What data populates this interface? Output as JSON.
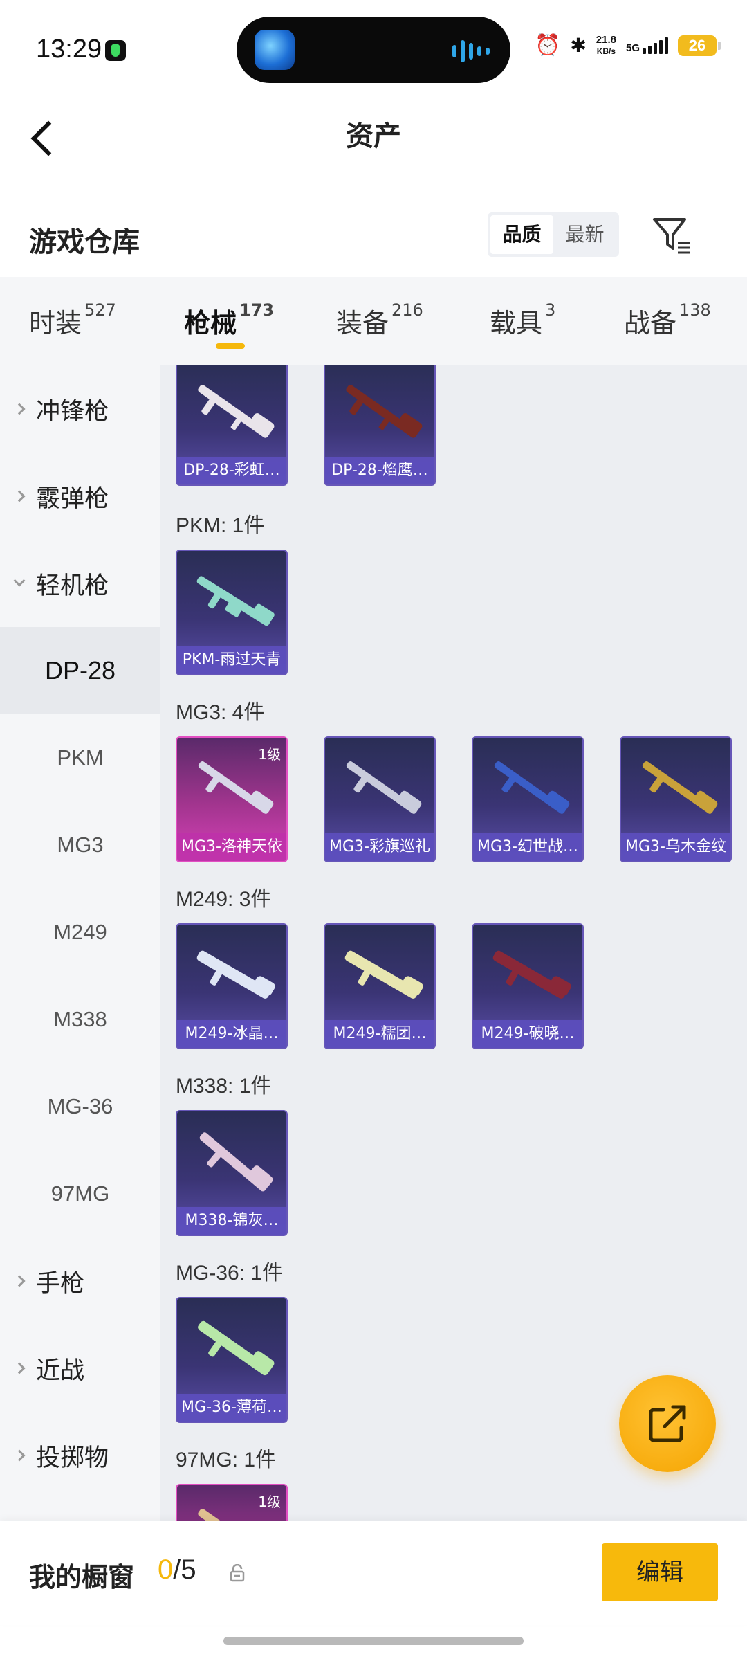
{
  "status_bar": {
    "time": "13:29",
    "speed": "21.8",
    "speed_unit": "KB/s",
    "network": "5G",
    "battery": "26"
  },
  "nav": {
    "title": "资产"
  },
  "warehouse": {
    "title": "游戏仓库",
    "sort_options": [
      "品质",
      "最新"
    ],
    "active_sort": "品质"
  },
  "tabs": [
    {
      "label": "时装",
      "count": "527"
    },
    {
      "label": "枪械",
      "count": "173",
      "active": true
    },
    {
      "label": "装备",
      "count": "216"
    },
    {
      "label": "载具",
      "count": "3"
    },
    {
      "label": "战备",
      "count": "138"
    }
  ],
  "sidebar": {
    "items": [
      {
        "label": "冲锋枪",
        "type": "group"
      },
      {
        "label": "霰弹枪",
        "type": "group"
      },
      {
        "label": "轻机枪",
        "type": "group",
        "open": true
      },
      {
        "label": "DP-28",
        "type": "sub",
        "selected": true
      },
      {
        "label": "PKM",
        "type": "sub"
      },
      {
        "label": "MG3",
        "type": "sub"
      },
      {
        "label": "M249",
        "type": "sub"
      },
      {
        "label": "M338",
        "type": "sub"
      },
      {
        "label": "MG-36",
        "type": "sub"
      },
      {
        "label": "97MG",
        "type": "sub"
      },
      {
        "label": "手枪",
        "type": "group"
      },
      {
        "label": "近战",
        "type": "group"
      },
      {
        "label": "投掷物",
        "type": "group"
      }
    ]
  },
  "groups": [
    {
      "label": "",
      "items": [
        {
          "name": "DP-28-彩虹…",
          "tier": "epic",
          "gun_color": "#e9e4ea"
        },
        {
          "name": "DP-28-焰鹰…",
          "tier": "epic",
          "gun_color": "#7a2a22"
        }
      ]
    },
    {
      "label": "PKM: 1件",
      "items": [
        {
          "name": "PKM-雨过天青",
          "tier": "epic",
          "gun_color": "#8fd9c9"
        }
      ]
    },
    {
      "label": "MG3: 4件",
      "items": [
        {
          "name": "MG3-洛神天依",
          "tier": "legendary",
          "level": "1级",
          "gun_color": "#d8d8e8"
        },
        {
          "name": "MG3-彩旗巡礼",
          "tier": "epic",
          "gun_color": "#c9ccdc"
        },
        {
          "name": "MG3-幻世战…",
          "tier": "epic",
          "gun_color": "#3a5ec8"
        },
        {
          "name": "MG3-乌木金纹",
          "tier": "epic",
          "gun_color": "#c9a23a"
        }
      ]
    },
    {
      "label": "M249: 3件",
      "items": [
        {
          "name": "M249-冰晶…",
          "tier": "epic",
          "gun_color": "#dfe6f5"
        },
        {
          "name": "M249-糯团…",
          "tier": "epic",
          "gun_color": "#e8e6b0"
        },
        {
          "name": "M249-破晓…",
          "tier": "epic",
          "gun_color": "#8a2838"
        }
      ]
    },
    {
      "label": "M338: 1件",
      "items": [
        {
          "name": "M338-锦灰…",
          "tier": "epic",
          "gun_color": "#e0c8dc"
        }
      ]
    },
    {
      "label": "MG-36: 1件",
      "items": [
        {
          "name": "MG-36-薄荷…",
          "tier": "epic",
          "gun_color": "#b8e8a8"
        }
      ]
    },
    {
      "label": "97MG: 1件",
      "items": [
        {
          "name": "",
          "tier": "legendary",
          "level": "1级",
          "gun_color": "#e0c090"
        }
      ]
    }
  ],
  "bottom_bar": {
    "title": "我的橱窗",
    "current": "0",
    "max": "5",
    "edit_label": "编辑"
  },
  "colors": {
    "accent": "#f5b80c",
    "epic_card": "#3a3474",
    "legendary_card": "#a3358f"
  }
}
